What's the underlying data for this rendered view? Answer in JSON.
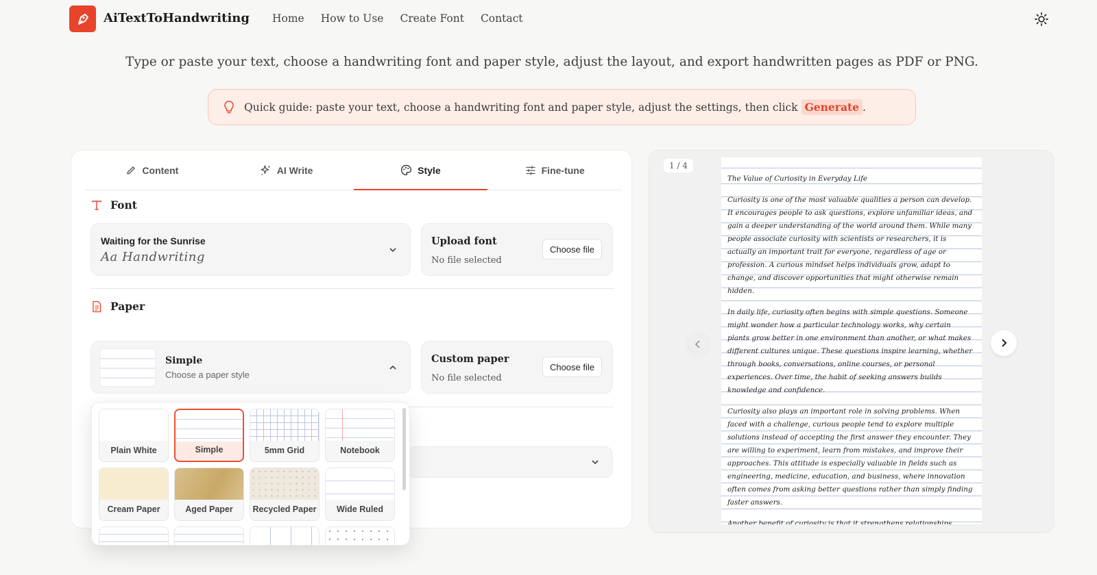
{
  "header": {
    "brand": "AiTextToHandwriting",
    "nav": [
      "Home",
      "How to Use",
      "Create Font",
      "Contact"
    ]
  },
  "intro": "Type or paste your text, choose a handwriting font and paper style, adjust the layout, and export handwritten pages as PDF or PNG.",
  "guide": {
    "text": "Quick guide: paste your text, choose a handwriting font and paper style, adjust the settings, then click",
    "link": "Generate",
    "suffix": "."
  },
  "tabs": [
    {
      "label": "Content",
      "icon": "pencil-icon"
    },
    {
      "label": "AI Write",
      "icon": "sparkles-icon"
    },
    {
      "label": "Style",
      "icon": "palette-icon",
      "active": true
    },
    {
      "label": "Fine-tune",
      "icon": "sliders-icon"
    }
  ],
  "font_section": {
    "title": "Font",
    "selected_font": "Waiting for the Sunrise",
    "sample": "Aa Handwriting",
    "upload": {
      "title": "Upload font",
      "button": "Choose file",
      "status": "No file selected"
    }
  },
  "paper_section": {
    "title": "Paper",
    "selected": "Simple",
    "hint": "Choose a paper style",
    "custom": {
      "title": "Custom paper",
      "button": "Choose file",
      "status": "No file selected"
    },
    "options": [
      {
        "label": "Plain White",
        "style": "plain"
      },
      {
        "label": "Simple",
        "style": "simple",
        "selected": true
      },
      {
        "label": "5mm Grid",
        "style": "grid"
      },
      {
        "label": "Notebook",
        "style": "notebook"
      },
      {
        "label": "Cream Paper",
        "style": "cream"
      },
      {
        "label": "Aged Paper",
        "style": "aged"
      },
      {
        "label": "Recycled Paper",
        "style": "recycled"
      },
      {
        "label": "Wide Ruled",
        "style": "wide"
      }
    ]
  },
  "preview": {
    "page_indicator": "1 / 4",
    "title": "The Value of Curiosity in Everyday Life",
    "paragraphs": [
      "Curiosity is one of the most valuable qualities a person can develop. It encourages people to ask questions, explore unfamiliar ideas, and gain a deeper understanding of the world around them. While many people associate curiosity with scientists or researchers, it is actually an important trait for everyone, regardless of age or profession. A curious mindset helps individuals grow, adapt to change, and discover opportunities that might otherwise remain hidden.",
      "In daily life, curiosity often begins with simple questions. Someone might wonder how a particular technology works, why certain plants grow better in one environment than another, or what makes different cultures unique. These questions inspire learning, whether through books, conversations, online courses, or personal experiences. Over time, the habit of seeking answers builds knowledge and confidence.",
      "Curiosity also plays an important role in solving problems. When faced with a challenge, curious people tend to explore multiple solutions instead of accepting the first answer they encounter. They are willing to experiment, learn from mistakes, and improve their approaches. This attitude is especially valuable in fields such as engineering, medicine, education, and business, where innovation often comes from asking better questions rather than simply finding faster answers.",
      "Another benefit of curiosity is that it strengthens relationships. People who are genuinely interested in others usually become better listeners. They ask thoughtful questions, try to understand different perspectives,"
    ]
  },
  "colors": {
    "accent": "#e8432b",
    "guide_bg": "#fdeee8",
    "ruling": "#b7c3dd"
  }
}
